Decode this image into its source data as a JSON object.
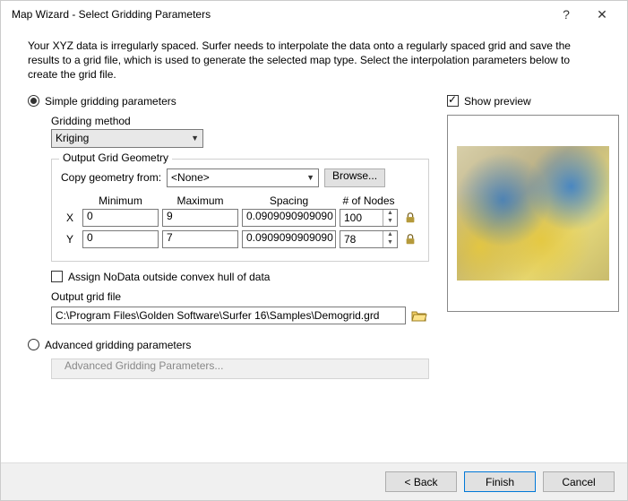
{
  "window": {
    "title": "Map Wizard - Select Gridding Parameters"
  },
  "intro": "Your XYZ data is irregularly spaced. Surfer needs to interpolate the data onto a regularly spaced grid and save the results to a grid file, which is used to generate the selected map type. Select the interpolation parameters below to create the grid file.",
  "simple_label": "Simple gridding parameters",
  "advanced_label": "Advanced gridding parameters",
  "gridding_method": {
    "label": "Gridding method",
    "value": "Kriging"
  },
  "geometry": {
    "legend": "Output Grid Geometry",
    "copy_label": "Copy geometry from:",
    "copy_value": "<None>",
    "browse": "Browse...",
    "headers": {
      "min": "Minimum",
      "max": "Maximum",
      "spacing": "Spacing",
      "nodes": "# of Nodes"
    },
    "x": {
      "label": "X",
      "min": "0",
      "max": "9",
      "spacing": "0.0909090909090",
      "nodes": "100"
    },
    "y": {
      "label": "Y",
      "min": "0",
      "max": "7",
      "spacing": "0.0909090909090",
      "nodes": "78"
    }
  },
  "assign_nodata": "Assign NoData outside convex hull of data",
  "output_grid": {
    "label": "Output grid file",
    "value": "C:\\Program Files\\Golden Software\\Surfer 16\\Samples\\Demogrid.grd"
  },
  "adv_button": "Advanced Gridding Parameters...",
  "preview_label": "Show preview",
  "footer": {
    "back": "< Back",
    "finish": "Finish",
    "cancel": "Cancel"
  }
}
